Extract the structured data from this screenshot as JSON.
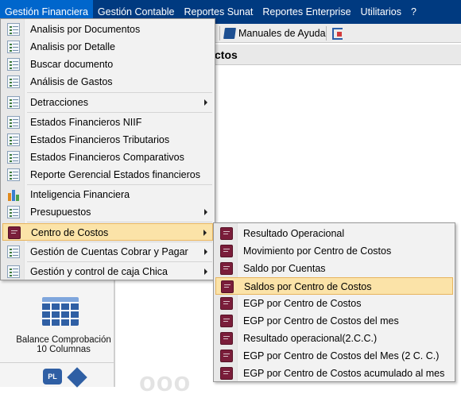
{
  "menubar": {
    "items": [
      {
        "label": "Gestión Financiera"
      },
      {
        "label": "Gestión Contable"
      },
      {
        "label": "Reportes Sunat"
      },
      {
        "label": "Reportes Enterprise"
      },
      {
        "label": "Utilitarios"
      },
      {
        "label": "?"
      }
    ]
  },
  "toolbar": {
    "manuales_label": "Manuales de Ayuda"
  },
  "window": {
    "title_fragment": "ctos"
  },
  "tile": {
    "label_line1": "Balance Comprobación",
    "label_line2": "10 Columnas",
    "pl_text": "PL"
  },
  "ghost": {
    "text": "ooo"
  },
  "menu": {
    "items": [
      {
        "label": "Analisis por Documentos",
        "icon": "document-list-icon"
      },
      {
        "label": "Analisis por Detalle",
        "icon": "document-list-icon"
      },
      {
        "label": "Buscar documento",
        "icon": "document-list-icon"
      },
      {
        "label": "Análisis de Gastos",
        "icon": "document-list-icon"
      },
      {
        "label": "Detracciones",
        "icon": "document-list-icon",
        "submenu": true
      },
      {
        "label": "Estados Financieros NIIF",
        "icon": "document-list-icon"
      },
      {
        "label": "Estados Financieros Tributarios",
        "icon": "document-list-icon"
      },
      {
        "label": "Estados Financieros Comparativos",
        "icon": "document-list-icon"
      },
      {
        "label": "Reporte Gerencial Estados financieros",
        "icon": "document-list-icon"
      },
      {
        "label": "Inteligencia Financiera",
        "icon": "bar-chart-icon"
      },
      {
        "label": "Presupuestos",
        "icon": "document-list-icon",
        "submenu": true
      },
      {
        "label": "Centro de Costos",
        "icon": "report-book-icon",
        "submenu": true,
        "highlighted": true
      },
      {
        "label": "Gestión de Cuentas Cobrar y Pagar",
        "icon": "document-list-icon",
        "submenu": true
      },
      {
        "label": "Gestión y control de caja Chica",
        "icon": "document-list-icon",
        "submenu": true
      }
    ]
  },
  "submenu": {
    "items": [
      {
        "label": "Resultado Operacional"
      },
      {
        "label": "Movimiento por Centro de Costos"
      },
      {
        "label": "Saldo por Cuentas"
      },
      {
        "label": "Saldos por Centro de Costos",
        "highlighted": true
      },
      {
        "label": "EGP por Centro de Costos"
      },
      {
        "label": "EGP por Centro de Costos del mes"
      },
      {
        "label": "Resultado operacional(2.C.C.)"
      },
      {
        "label": "EGP por Centro de Costos del Mes (2 C. C.)"
      },
      {
        "label": "EGP por Centro de Costos acumulado al mes"
      }
    ]
  },
  "colors": {
    "menubar_bg": "#003a80",
    "menubar_active": "#0066cc",
    "highlight_bg": "#fbe3a8",
    "highlight_border": "#e7b45e"
  }
}
